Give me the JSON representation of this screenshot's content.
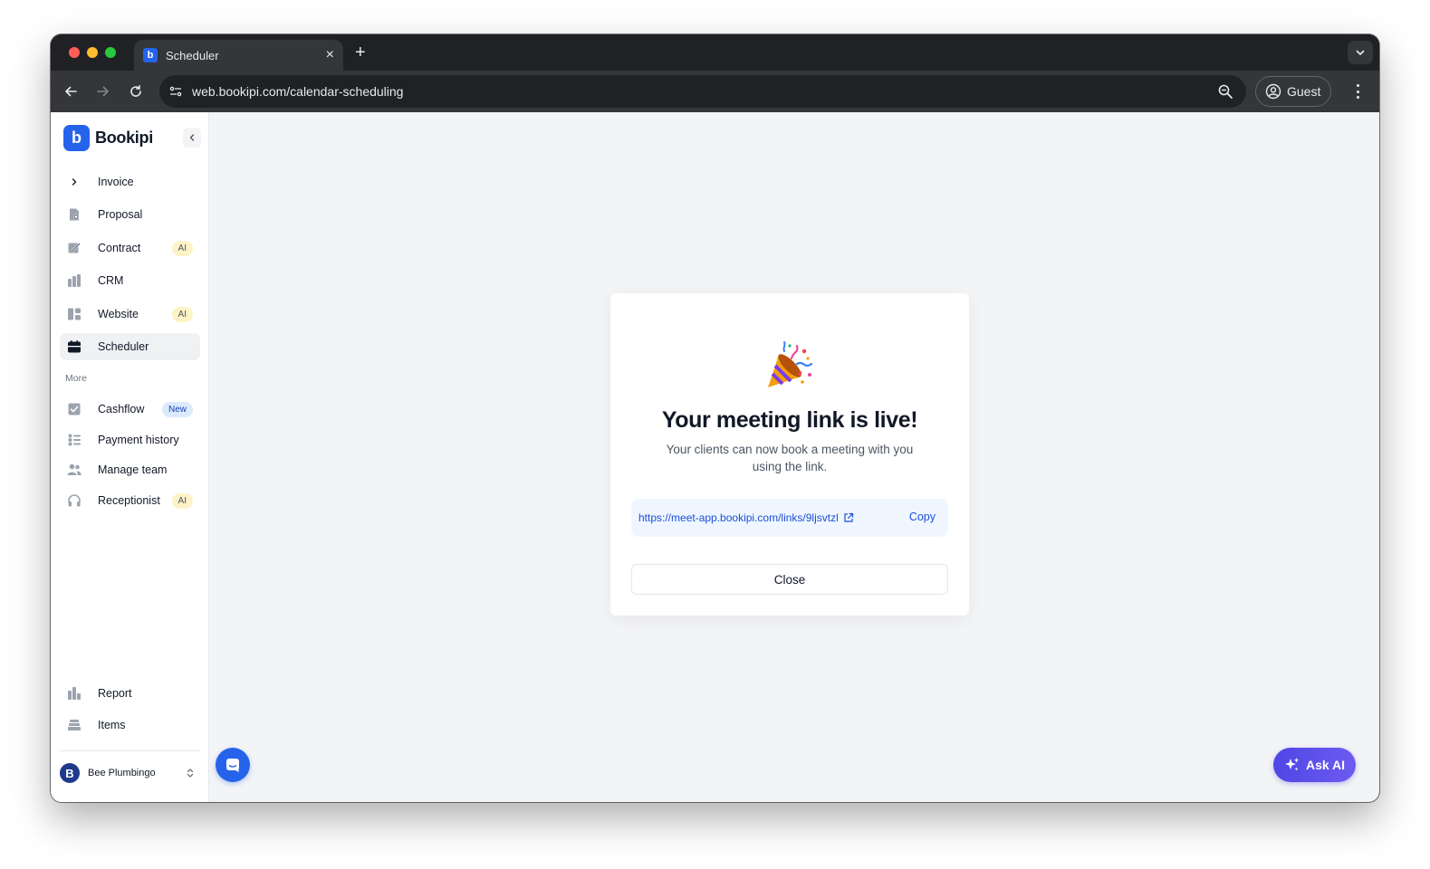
{
  "browser": {
    "tab_title": "Scheduler",
    "url": "web.bookipi.com/calendar-scheduling",
    "profile_label": "Guest"
  },
  "app": {
    "brand": "Bookipi",
    "nav_items": [
      {
        "label": "Invoice",
        "icon": "chevron-right-icon"
      },
      {
        "label": "Proposal",
        "icon": "proposal-icon"
      },
      {
        "label": "Contract",
        "icon": "contract-icon",
        "badge": "AI"
      },
      {
        "label": "CRM",
        "icon": "crm-icon"
      },
      {
        "label": "Website",
        "icon": "website-icon",
        "badge": "AI"
      },
      {
        "label": "Scheduler",
        "icon": "calendar-icon",
        "active": true
      }
    ],
    "more_label": "More",
    "more_items": [
      {
        "label": "Cashflow",
        "icon": "cashflow-icon",
        "badge": "New"
      },
      {
        "label": "Payment history",
        "icon": "payment-history-icon"
      },
      {
        "label": "Manage team",
        "icon": "team-icon"
      },
      {
        "label": "Receptionist",
        "icon": "headphones-icon",
        "badge": "AI"
      }
    ],
    "bottom_items": [
      {
        "label": "Report",
        "icon": "report-icon"
      },
      {
        "label": "Items",
        "icon": "items-icon"
      }
    ],
    "user": {
      "initial": "B",
      "name": "Bee Plumbingo"
    }
  },
  "modal": {
    "title": "Your meeting link is live!",
    "subtitle": "Your clients can now book a meeting with you using the link.",
    "link": "https://meet-app.bookipi.com/links/9ljsvtzl",
    "copy_label": "Copy",
    "close_label": "Close"
  },
  "ask_ai_label": "Ask AI",
  "colors": {
    "brand_blue": "#2563eb",
    "ask_ai_purple": "#5b50ec",
    "ai_badge": "#fef3c7",
    "new_badge": "#dbeafe"
  }
}
